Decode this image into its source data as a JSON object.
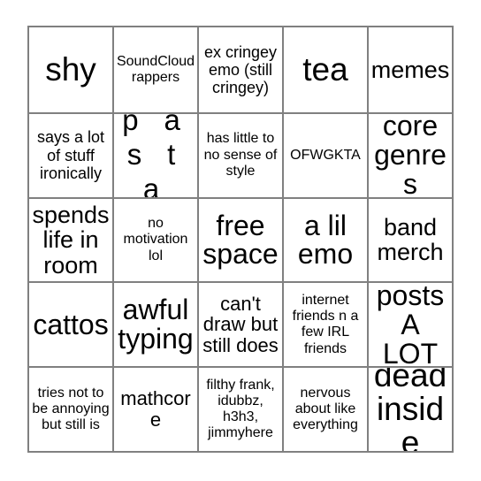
{
  "card": {
    "type": "bingo-card",
    "columns": 5,
    "rows": 5,
    "grid_line_color": "#808080",
    "background_color": "#ffffff",
    "text_color": "#000000",
    "cells": [
      {
        "text": "shy",
        "size": "fs-xxl"
      },
      {
        "text": "SoundCloud rappers",
        "size": "fs-xs"
      },
      {
        "text": "ex cringey emo (still cringey)",
        "size": "fs-s"
      },
      {
        "text": "tea",
        "size": "fs-xxl"
      },
      {
        "text": "memes",
        "size": "fs-l"
      },
      {
        "text": "says a lot of stuff ironically",
        "size": "fs-s"
      },
      {
        "text": "p a s t a",
        "size": "spaced"
      },
      {
        "text": "has little to no sense of style",
        "size": "fs-xs"
      },
      {
        "text": "OFWGKTA",
        "size": "fs-xs"
      },
      {
        "text": "core genres",
        "size": "fs-xl"
      },
      {
        "text": "spends life in room",
        "size": "fs-l"
      },
      {
        "text": "no motivation lol",
        "size": "fs-xs"
      },
      {
        "text": "free space",
        "size": "fs-xl"
      },
      {
        "text": "a lil emo",
        "size": "fs-xl"
      },
      {
        "text": "band merch",
        "size": "fs-l"
      },
      {
        "text": "cattos",
        "size": "fs-xl"
      },
      {
        "text": "awful typing",
        "size": "fs-xl"
      },
      {
        "text": "can't draw but still does",
        "size": "fs-m"
      },
      {
        "text": "internet friends n a few IRL friends",
        "size": "fs-xs"
      },
      {
        "text": "posts A LOT",
        "size": "fs-xl"
      },
      {
        "text": "tries not to be annoying but still is",
        "size": "fs-xs"
      },
      {
        "text": "mathcore",
        "size": "fs-m"
      },
      {
        "text": "filthy frank, idubbz, h3h3, jimmyhere",
        "size": "fs-xs"
      },
      {
        "text": "nervous about like everything",
        "size": "fs-xs"
      },
      {
        "text": "dead inside",
        "size": "fs-xxl"
      }
    ]
  }
}
